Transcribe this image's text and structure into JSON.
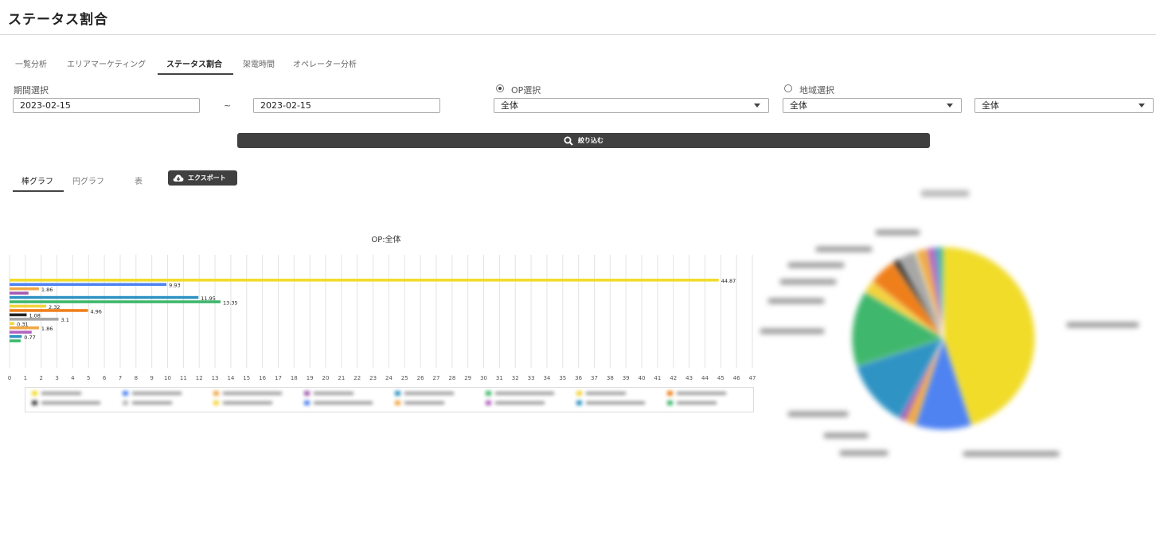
{
  "page": {
    "title": "ステータス割合"
  },
  "tabs": [
    {
      "label": "一覧分析"
    },
    {
      "label": "エリアマーケティング"
    },
    {
      "label": "ステータス割合",
      "active": true
    },
    {
      "label": "架電時間"
    },
    {
      "label": "オペレーター分析"
    }
  ],
  "filters": {
    "period_label": "期間選択",
    "date_from": "2023-02-15",
    "tilde": "~",
    "date_to": "2023-02-15",
    "op_radio_label": "OP選択",
    "op_radio_selected": true,
    "area_radio_label": "地域選択",
    "area_radio_selected": false,
    "op_select_value": "全体",
    "area_select_value": "全体",
    "area2_select_value": "全体",
    "submit_label": "絞り込む"
  },
  "subtabs": [
    {
      "label": "棒グラフ",
      "active": true
    },
    {
      "label": "円グラフ"
    },
    {
      "label": "表"
    }
  ],
  "export_label": "エクスポート",
  "colors": {
    "dark_button": "#404040",
    "grid": "#e3e3e3"
  },
  "chart_data": [
    {
      "type": "bar",
      "orientation": "horizontal",
      "title": "OP:全体",
      "xlim": [
        0,
        47
      ],
      "x_ticks": [
        0,
        1,
        2,
        3,
        4,
        5,
        6,
        7,
        8,
        9,
        10,
        11,
        12,
        13,
        14,
        15,
        16,
        17,
        18,
        19,
        20,
        21,
        22,
        23,
        24,
        25,
        26,
        27,
        28,
        29,
        30,
        31,
        32,
        33,
        34,
        35,
        36,
        37,
        38,
        39,
        40,
        41,
        42,
        43,
        44,
        45,
        46,
        47
      ],
      "grid": true,
      "legend": "bottom",
      "bars": [
        {
          "value": 44.87,
          "label": "44.87",
          "color": "#f1dc2a"
        },
        {
          "value": 9.93,
          "label": "9.93",
          "color": "#4f83f2"
        },
        {
          "value": 1.86,
          "label": "1.86",
          "color": "#f0a844"
        },
        {
          "value": 1.2,
          "label": "",
          "color": "#a35bb0"
        },
        {
          "value": 11.95,
          "label": "11.95",
          "color": "#2f93c4"
        },
        {
          "value": 13.35,
          "label": "13.35",
          "color": "#3fb76c"
        },
        {
          "value": 2.32,
          "label": "2.32",
          "color": "#f3d23a"
        },
        {
          "value": 4.96,
          "label": "4.96",
          "color": "#ef7f1a"
        },
        {
          "value": 1.08,
          "label": "1.08",
          "color": "#222222"
        },
        {
          "value": 3.1,
          "label": "3.1",
          "color": "#a7a7a7"
        },
        {
          "value": 0.31,
          "label": "0.31",
          "color": "#f4d642"
        },
        {
          "value": 1.86,
          "label": "1.86",
          "color": "#f0a844"
        },
        {
          "value": 1.4,
          "label": "",
          "color": "#b263c0"
        },
        {
          "value": 0.77,
          "label": "0.77",
          "color": "#2f93c4"
        },
        {
          "value": 0.7,
          "label": "",
          "color": "#3fb76c"
        }
      ],
      "legend_colors": [
        "#f1dc2a",
        "#4f83f2",
        "#f0a844",
        "#a35bb0",
        "#2f93c4",
        "#3fb76c",
        "#f3d23a",
        "#ef7f1a",
        "#444444",
        "#bbbbbb",
        "#f4d642",
        "#4f83f2",
        "#f0a844",
        "#b263c0",
        "#2f93c4",
        "#3fb76c"
      ]
    },
    {
      "type": "pie",
      "title": "",
      "slices": [
        {
          "value": 44.87,
          "color": "#f1dc2a"
        },
        {
          "value": 9.93,
          "color": "#4f83f2"
        },
        {
          "value": 1.86,
          "color": "#f0a844"
        },
        {
          "value": 1.2,
          "color": "#a35bb0"
        },
        {
          "value": 11.95,
          "color": "#2f93c4"
        },
        {
          "value": 13.35,
          "color": "#3fb76c"
        },
        {
          "value": 2.32,
          "color": "#f3d23a"
        },
        {
          "value": 4.96,
          "color": "#ef7f1a"
        },
        {
          "value": 1.08,
          "color": "#222222"
        },
        {
          "value": 3.1,
          "color": "#a7a7a7"
        },
        {
          "value": 0.31,
          "color": "#f4d642"
        },
        {
          "value": 1.86,
          "color": "#f0a844"
        },
        {
          "value": 1.4,
          "color": "#b263c0"
        },
        {
          "value": 0.77,
          "color": "#2f93c4"
        },
        {
          "value": 0.7,
          "color": "#3fb76c"
        }
      ]
    }
  ]
}
